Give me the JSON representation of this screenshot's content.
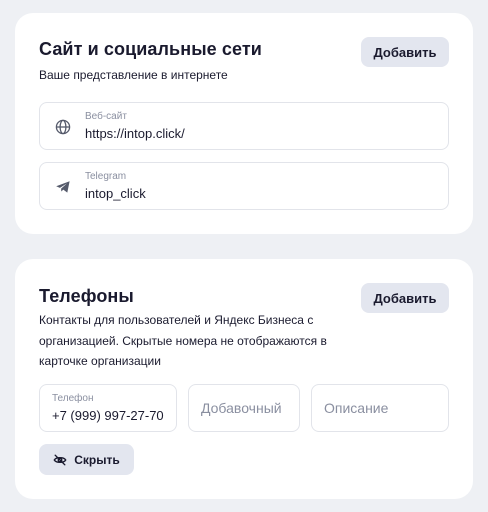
{
  "sites": {
    "title": "Сайт и социальные сети",
    "subtitle": "Ваше представление в интернете",
    "add_label": "Добавить",
    "fields": [
      {
        "label": "Веб-сайт",
        "value": "https://intop.click/",
        "icon": "globe-icon"
      },
      {
        "label": "Telegram",
        "value": "intop_click",
        "icon": "telegram-icon"
      }
    ]
  },
  "phones": {
    "title": "Телефоны",
    "add_label": "Добавить",
    "description": "Контакты для пользователей и Яндекс Бизнеса с организацией. Скрытые номера не отображаются в карточке организации",
    "phone_label": "Телефон",
    "phone_value": "+7 (999) 997-27-70",
    "extension_placeholder": "Добавочный",
    "description_placeholder": "Описание",
    "hide_label": "Скрыть",
    "hide_icon": "eye-off-icon"
  },
  "colors": {
    "background": "#eef0f4",
    "card": "#ffffff",
    "button": "#e3e6ef",
    "muted_text": "#8a8fa0"
  }
}
